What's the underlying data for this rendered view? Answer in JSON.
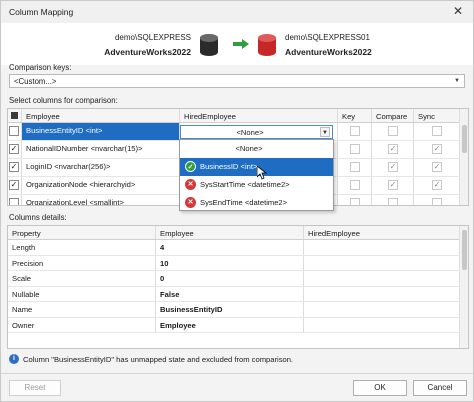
{
  "window": {
    "title": "Column Mapping",
    "close_glyph": "✕"
  },
  "header": {
    "source_server": "demo\\SQLEXPRESS",
    "source_db": "AdventureWorks2022",
    "target_server": "demo\\SQLEXPRESS01",
    "target_db": "AdventureWorks2022",
    "source_icon": "database-icon",
    "target_icon": "database-icon",
    "source_color": "#2b2b2b",
    "target_color": "#c62828",
    "arrow_color": "#2e9e3f"
  },
  "comparison_keys": {
    "label": "Comparison keys:",
    "value": "<Custom...>"
  },
  "columns_section": {
    "label": "Select columns for comparison:",
    "headers": {
      "employee": "Employee",
      "hired": "HiredEmployee",
      "key": "Key",
      "compare": "Compare",
      "sync": "Sync"
    },
    "rows": [
      {
        "employee": "BusinessEntityID <int>",
        "hired": "<None>",
        "row_checked": false,
        "compare": false,
        "sync": false
      },
      {
        "employee": "NationalIDNumber <nvarchar(15)>",
        "hired": "",
        "row_checked": true,
        "compare": true,
        "sync": true
      },
      {
        "employee": "LoginID <nvarchar(256)>",
        "hired": "",
        "row_checked": true,
        "compare": true,
        "sync": true
      },
      {
        "employee": "OrganizationNode <hierarchyid>",
        "hired": "",
        "row_checked": true,
        "compare": true,
        "sync": true
      },
      {
        "employee": "OrganizationLevel <smallint>",
        "hired": "",
        "row_checked": false,
        "compare": false,
        "sync": false
      }
    ],
    "check_glyph": "✓"
  },
  "dropdown": {
    "items": [
      {
        "label": "<None>",
        "icon": "",
        "highlighted": false
      },
      {
        "label": "BusinessID <int>",
        "icon": "check-circle-icon",
        "highlighted": true
      },
      {
        "label": "SysStartTime <datetime2>",
        "icon": "error-circle-icon",
        "highlighted": false
      },
      {
        "label": "SysEndTime <datetime2>",
        "icon": "error-circle-icon",
        "highlighted": false
      }
    ]
  },
  "details_section": {
    "label": "Columns details:",
    "headers": {
      "property": "Property",
      "employee": "Employee",
      "hired": "HiredEmployee"
    },
    "rows": [
      {
        "property": "Length",
        "employee": "4",
        "hired": ""
      },
      {
        "property": "Precision",
        "employee": "10",
        "hired": ""
      },
      {
        "property": "Scale",
        "employee": "0",
        "hired": ""
      },
      {
        "property": "Nullable",
        "employee": "False",
        "hired": ""
      },
      {
        "property": "Name",
        "employee": "BusinessEntityID",
        "hired": ""
      },
      {
        "property": "Owner",
        "employee": "Employee",
        "hired": ""
      }
    ]
  },
  "info": {
    "icon": "info-icon",
    "text": "Column \"BusinessEntityID\" has unmapped state and excluded from comparison."
  },
  "footer": {
    "reset_label": "Reset",
    "ok_label": "OK",
    "cancel_label": "Cancel"
  }
}
